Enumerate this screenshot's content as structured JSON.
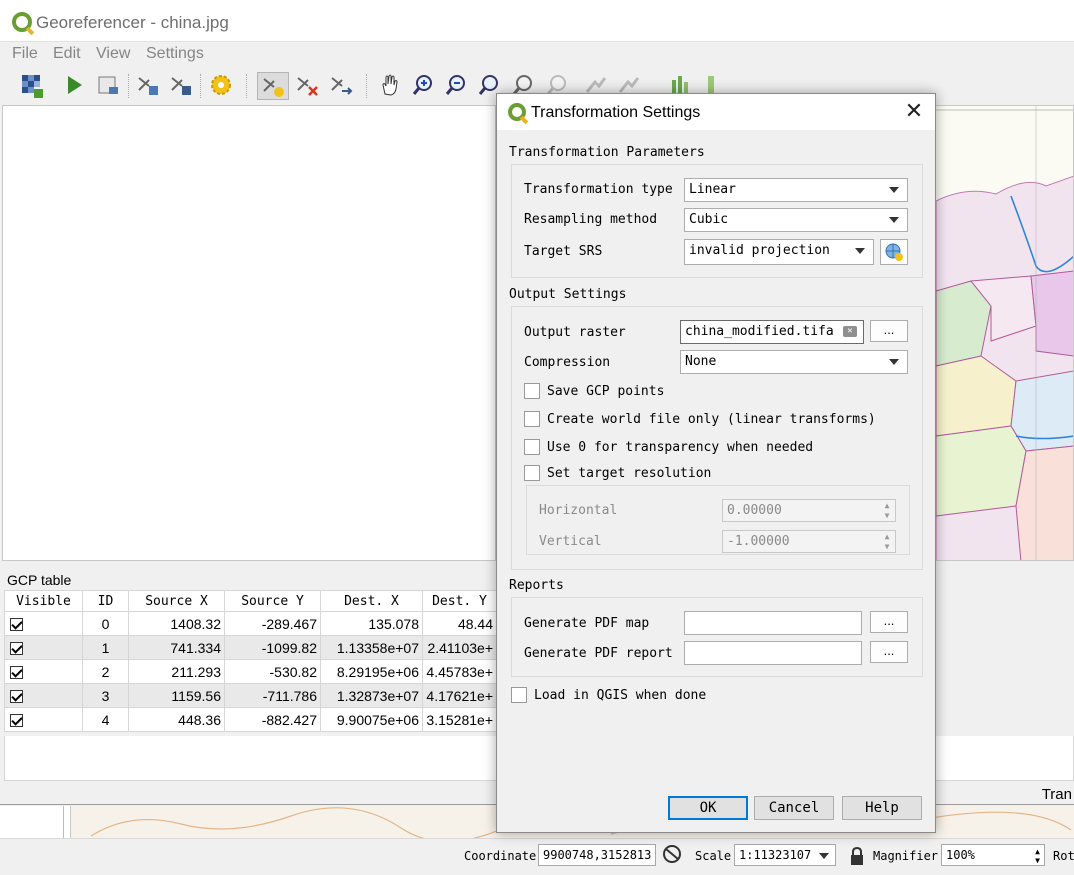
{
  "window": {
    "title": "Georeferencer - china.jpg"
  },
  "menu": [
    "File",
    "Edit",
    "View",
    "Settings"
  ],
  "toolbar_icons": [
    "open-raster-icon",
    "start-georeferencing-icon",
    "generate-gdal-script-icon",
    "load-gcp-icon",
    "save-gcp-icon",
    "transformation-settings-icon",
    "add-point-icon",
    "delete-point-icon",
    "move-gcp-icon",
    "pan-icon",
    "zoom-in-icon",
    "zoom-out-icon",
    "zoom-to-layer-icon",
    "zoom-last-icon",
    "zoom-next-icon",
    "link-georef-icon",
    "link-qgis-icon",
    "histogram-stretch-icon",
    "local-histogram-icon"
  ],
  "gcp": {
    "title": "GCP table",
    "columns": [
      "Visible",
      "ID",
      "Source X",
      "Source Y",
      "Dest. X",
      "Dest. Y"
    ],
    "rows": [
      {
        "visible": true,
        "id": "0",
        "source_x": "1408.32",
        "source_y": "-289.467",
        "dest_x": "135.078",
        "dest_y": "48.44"
      },
      {
        "visible": true,
        "id": "1",
        "source_x": "741.334",
        "source_y": "-1099.82",
        "dest_x": "1.13358e+07",
        "dest_y": "2.41103e+"
      },
      {
        "visible": true,
        "id": "2",
        "source_x": "211.293",
        "source_y": "-530.82",
        "dest_x": "8.29195e+06",
        "dest_y": "4.45783e+"
      },
      {
        "visible": true,
        "id": "3",
        "source_x": "1159.56",
        "source_y": "-711.786",
        "dest_x": "1.32873e+07",
        "dest_y": "4.17621e+"
      },
      {
        "visible": true,
        "id": "4",
        "source_x": "448.36",
        "source_y": "-882.427",
        "dest_x": "9.90075e+06",
        "dest_y": "3.15281e+"
      }
    ],
    "trailing_label": "Tran"
  },
  "status": {
    "coordinate_label": "Coordinate",
    "coordinate_value": "9900748,3152813",
    "scale_label": "Scale",
    "scale_value": "1:11323107",
    "magnifier_label": "Magnifier",
    "magnifier_value": "100%",
    "rotation_label": "Rot"
  },
  "dialog": {
    "title": "Transformation Settings",
    "transformation_params": {
      "section": "Transformation Parameters",
      "type_label": "Transformation type",
      "type_value": "Linear",
      "resampling_label": "Resampling method",
      "resampling_value": "Cubic",
      "srs_label": "Target SRS",
      "srs_value": "invalid projection"
    },
    "output": {
      "section": "Output Settings",
      "raster_label": "Output raster",
      "raster_value": "china_modified.tifa",
      "compression_label": "Compression",
      "compression_value": "None",
      "save_gcp": "Save GCP points",
      "world_file": "Create world file only (linear transforms)",
      "use_zero": "Use 0 for transparency when needed",
      "target_res": "Set target resolution",
      "horizontal_label": "Horizontal",
      "horizontal_value": "0.00000",
      "vertical_label": "Vertical",
      "vertical_value": "-1.00000"
    },
    "reports": {
      "section": "Reports",
      "pdf_map_label": "Generate PDF map",
      "pdf_map_value": "",
      "pdf_report_label": "Generate PDF report",
      "pdf_report_value": ""
    },
    "browse_label": "...",
    "load_in_qgis": "Load in QGIS when done",
    "buttons": {
      "ok": "OK",
      "cancel": "Cancel",
      "help": "Help"
    }
  }
}
